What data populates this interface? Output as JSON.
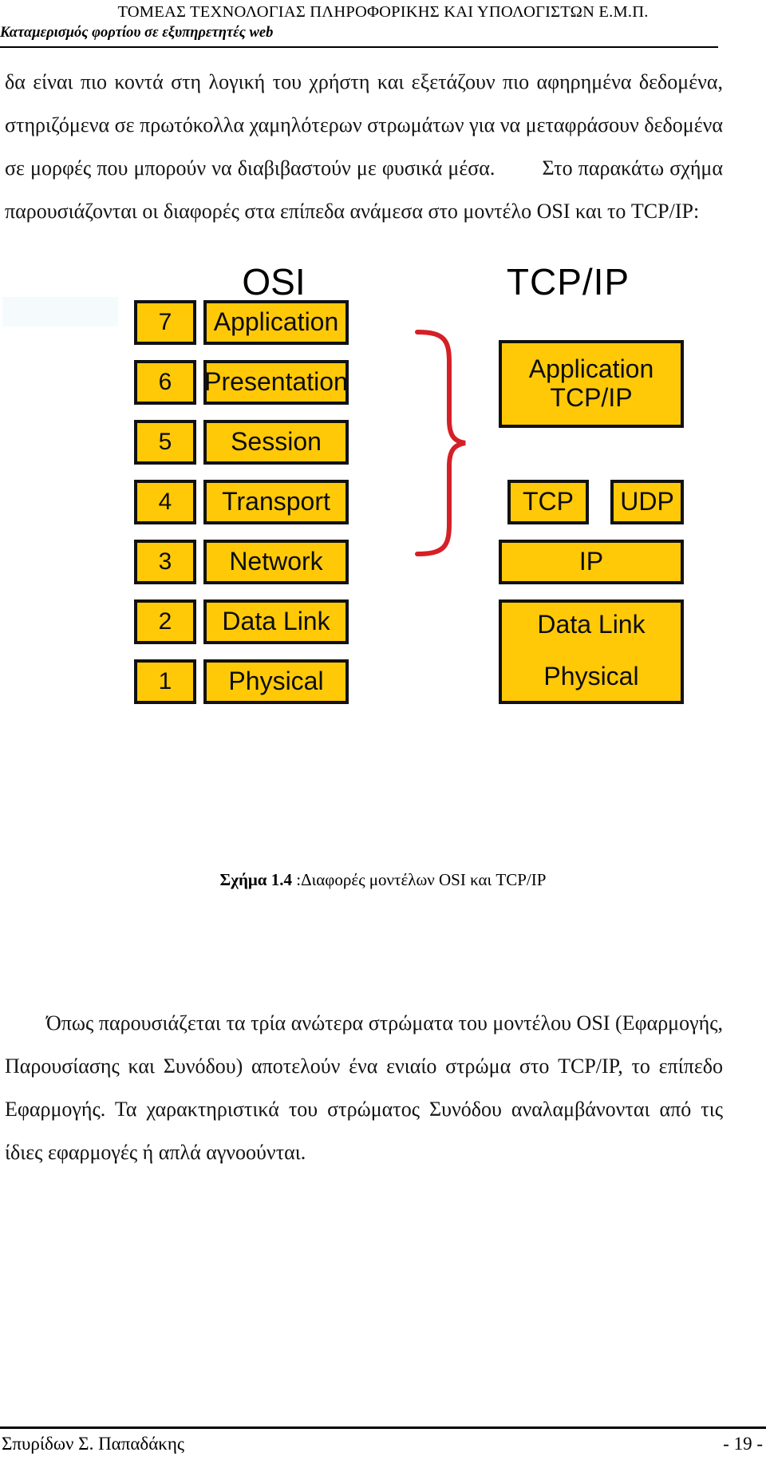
{
  "running_head": {
    "department": "ΤΟΜΕΑΣ  ΤΕΧΝΟΛΟΓΙΑΣ ΠΛΗΡΟΦΟΡΙΚΗΣ ΚΑΙ ΥΠΟΛΟΓΙΣΤΩΝ Ε.Μ.Π.",
    "thesis_title": "Καταμερισμός φορτίου σε εξυπηρετητές web"
  },
  "paragraphs": {
    "p1": "δα είναι πιο κοντά στη λογική του χρήστη και εξετάζουν πιο αφηρημένα δεδομένα, στηριζόμενα σε πρωτόκολλα χαμηλότερων στρωμάτων για να μεταφράσουν δεδομένα σε μορφές που μπορούν να διαβιβαστούν με φυσικά μέσα.",
    "p1b": "Στο παρακάτω σχήμα παρουσιάζονται οι διαφορές στα επίπεδα ανάμεσα στο μοντέλο OSI και το TCP/IP:",
    "p2": "Όπως παρουσιάζεται τα τρία ανώτερα στρώματα του μοντέλου OSI (Εφαρμογής, Παρουσίασης και Συνόδου) αποτελούν ένα ενιαίο στρώμα στο TCP/IP, το επίπεδο Εφαρμογής. Τα χαρακτηριστικά του στρώματος Συνόδου αναλαμβάνονται από τις ίδιες εφαρμογές ή απλά αγνοούνται."
  },
  "figure": {
    "caption_label": "Σχήμα 1.4",
    "caption_text": " :Διαφορές μοντέλων OSI και TCP/IP",
    "osi_title": "OSI",
    "tcpip_title": "TCP/IP",
    "colors": {
      "box_fill": "#FFC907",
      "box_border": "#111111",
      "brace": "#D42026",
      "pale_block": "#F5FAFD"
    },
    "osi_layers": [
      {
        "number": "7",
        "name": "Application"
      },
      {
        "number": "6",
        "name": "Presentation"
      },
      {
        "number": "5",
        "name": "Session"
      },
      {
        "number": "4",
        "name": "Transport"
      },
      {
        "number": "3",
        "name": "Network"
      },
      {
        "number": "2",
        "name": "Data Link"
      },
      {
        "number": "1",
        "name": "Physical"
      }
    ],
    "tcpip_layers": [
      {
        "name": "Application\nTCP/IP"
      },
      {
        "name": "TCP"
      },
      {
        "name": "UDP"
      },
      {
        "name": "IP"
      },
      {
        "name": "Data Link"
      },
      {
        "name": "Physical"
      }
    ]
  },
  "footer": {
    "author": "Σπυρίδων Σ. Παπαδάκης",
    "page_number": "- 19 -"
  }
}
